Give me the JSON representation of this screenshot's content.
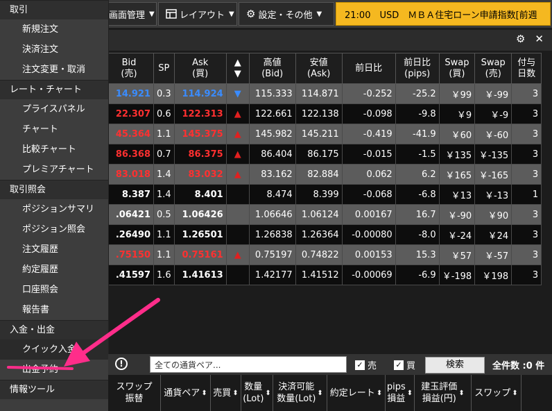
{
  "toolbar": {
    "btn1_label": "画面管理",
    "btn2_label": "レイアウト",
    "btn3_label": "設定・その他",
    "ticker_text": "21:00　USD　ＭＢＡ住宅ローン申請指数[前週"
  },
  "sidebar": {
    "sections": [
      {
        "title": "取引",
        "items": [
          "新規注文",
          "決済注文",
          "注文変更・取消"
        ]
      },
      {
        "title": "レート・チャート",
        "items": [
          "プライスパネル",
          "チャート",
          "比較チャート",
          "プレミアチャート"
        ]
      },
      {
        "title": "取引照会",
        "items": [
          "ポジションサマリ",
          "ポジション照会",
          "注文履歴",
          "約定履歴",
          "口座照会",
          "報告書"
        ]
      },
      {
        "title": "入金・出金",
        "items": [
          "クイック入金",
          "出金予約"
        ]
      },
      {
        "title": "情報ツール",
        "items": []
      }
    ]
  },
  "rate_table": {
    "headers": {
      "bid": "Bid",
      "bid_sub": "(売)",
      "sp": "SP",
      "ask": "Ask",
      "ask_sub": "(買)",
      "updown_up": "▲",
      "updown_down": "▼",
      "high": "高値",
      "high_sub": "(Bid)",
      "low": "安値",
      "low_sub": "(Ask)",
      "change": "前日比",
      "change_pips": "前日比",
      "change_pips_sub": "(pips)",
      "swap_buy": "Swap",
      "swap_buy_sub": "(買)",
      "swap_sell": "Swap",
      "swap_sell_sub": "(売)",
      "days": "付与",
      "days_sub": "日数"
    },
    "rows": [
      {
        "bid": "14.921",
        "sp": "0.3",
        "ask": "114.924",
        "dir": "down",
        "arrow": "▼",
        "high": "115.333",
        "low": "114.871",
        "change": "-0.252",
        "pips": "-25.2",
        "swap_buy": "￥99",
        "swap_sell": "￥-99",
        "days": "3",
        "shade": "light"
      },
      {
        "bid": "22.307",
        "sp": "0.6",
        "ask": "122.313",
        "dir": "up",
        "arrow": "▲",
        "high": "122.661",
        "low": "122.138",
        "change": "-0.098",
        "pips": "-9.8",
        "swap_buy": "￥9",
        "swap_sell": "￥-9",
        "days": "3",
        "shade": "dark"
      },
      {
        "bid": "45.364",
        "sp": "1.1",
        "ask": "145.375",
        "dir": "up",
        "arrow": "▲",
        "high": "145.982",
        "low": "145.211",
        "change": "-0.419",
        "pips": "-41.9",
        "swap_buy": "￥60",
        "swap_sell": "￥-60",
        "days": "3",
        "shade": "light"
      },
      {
        "bid": "86.368",
        "sp": "0.7",
        "ask": "86.375",
        "dir": "up",
        "arrow": "▲",
        "high": "86.404",
        "low": "86.175",
        "change": "-0.015",
        "pips": "-1.5",
        "swap_buy": "￥135",
        "swap_sell": "￥-135",
        "days": "3",
        "shade": "dark"
      },
      {
        "bid": "83.018",
        "sp": "1.4",
        "ask": "83.032",
        "dir": "up",
        "arrow": "▲",
        "high": "83.162",
        "low": "82.884",
        "change": "0.062",
        "pips": "6.2",
        "swap_buy": "￥165",
        "swap_sell": "￥-165",
        "days": "3",
        "shade": "light"
      },
      {
        "bid": "8.387",
        "sp": "1.4",
        "ask": "8.401",
        "dir": "flat",
        "arrow": "",
        "high": "8.474",
        "low": "8.399",
        "change": "-0.068",
        "pips": "-6.8",
        "swap_buy": "￥13",
        "swap_sell": "￥-13",
        "days": "1",
        "shade": "dark"
      },
      {
        "bid": ".06421",
        "sp": "0.5",
        "ask": "1.06426",
        "dir": "flat",
        "arrow": "",
        "high": "1.06646",
        "low": "1.06124",
        "change": "0.00167",
        "pips": "16.7",
        "swap_buy": "￥-90",
        "swap_sell": "￥90",
        "days": "3",
        "shade": "light"
      },
      {
        "bid": ".26490",
        "sp": "1.1",
        "ask": "1.26501",
        "dir": "flat",
        "arrow": "",
        "high": "1.26838",
        "low": "1.26364",
        "change": "-0.00080",
        "pips": "-8.0",
        "swap_buy": "￥-24",
        "swap_sell": "￥24",
        "days": "3",
        "shade": "dark"
      },
      {
        "bid": ".75150",
        "sp": "1.1",
        "ask": "0.75161",
        "dir": "up",
        "arrow": "▲",
        "high": "0.75197",
        "low": "0.74822",
        "change": "0.00153",
        "pips": "15.3",
        "swap_buy": "￥57",
        "swap_sell": "￥-57",
        "days": "3",
        "shade": "light"
      },
      {
        "bid": ".41597",
        "sp": "1.6",
        "ask": "1.41613",
        "dir": "flat",
        "arrow": "",
        "high": "1.42177",
        "low": "1.41512",
        "change": "-0.00069",
        "pips": "-6.9",
        "swap_buy": "￥-198",
        "swap_sell": "￥198",
        "days": "3",
        "shade": "dark"
      }
    ]
  },
  "filter": {
    "currency_placeholder": "全ての通貨ペア...",
    "sell_label": "売",
    "buy_label": "買",
    "checkmark": "✓",
    "search_label": "検索",
    "total_label": "全件数 :0 件",
    "info_glyph": "!"
  },
  "position_headers": [
    "スワップ\n振替",
    "通貨ペア",
    "売買",
    "数量\n(Lot)",
    "決済可能\n数量(Lot)",
    "約定レート",
    "pips\n損益",
    "建玉評価\n損益(円)",
    "スワップ"
  ],
  "panel_icons": {
    "gear": "⚙",
    "close": "✕"
  }
}
